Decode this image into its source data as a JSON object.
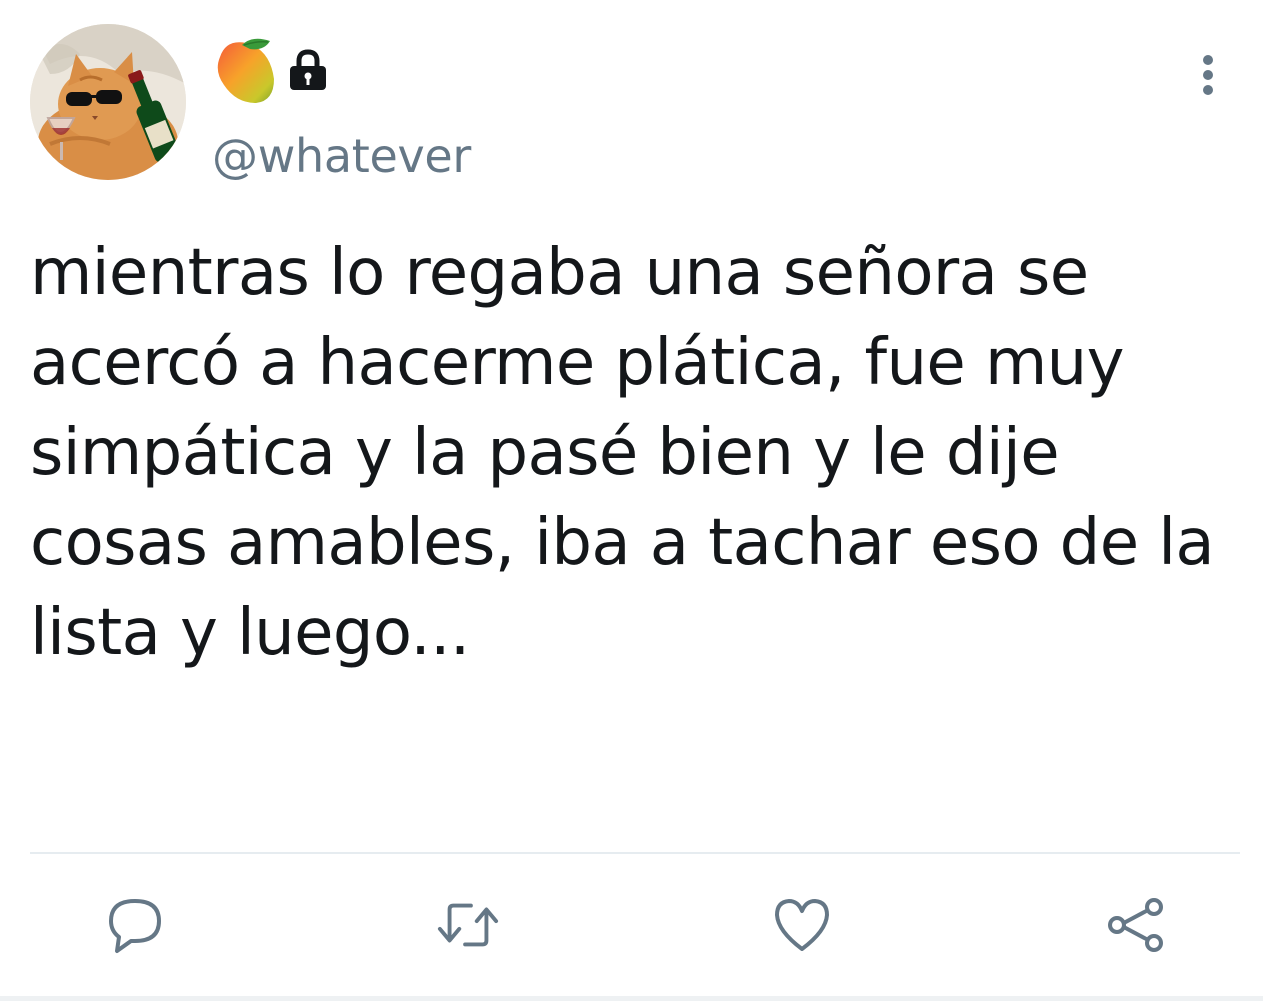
{
  "tweet": {
    "name_icons": [
      "mango-emoji-icon",
      "lock-icon"
    ],
    "handle": "@whatever",
    "text": "mientras lo regaba una señora se acercó a hacerme plática, fue muy simpática y la pasé bien y le dije cosas amables, iba a tachar eso de la lista y luego...",
    "avatar": "cat-with-sunglasses-and-wine-bottle"
  },
  "actions": {
    "icons": [
      "reply-icon",
      "retweet-icon",
      "like-icon",
      "share-icon"
    ],
    "icon_color": "#657786"
  },
  "colors": {
    "text": "#14171a",
    "secondary": "#657786",
    "divider": "#e6ecf0"
  }
}
